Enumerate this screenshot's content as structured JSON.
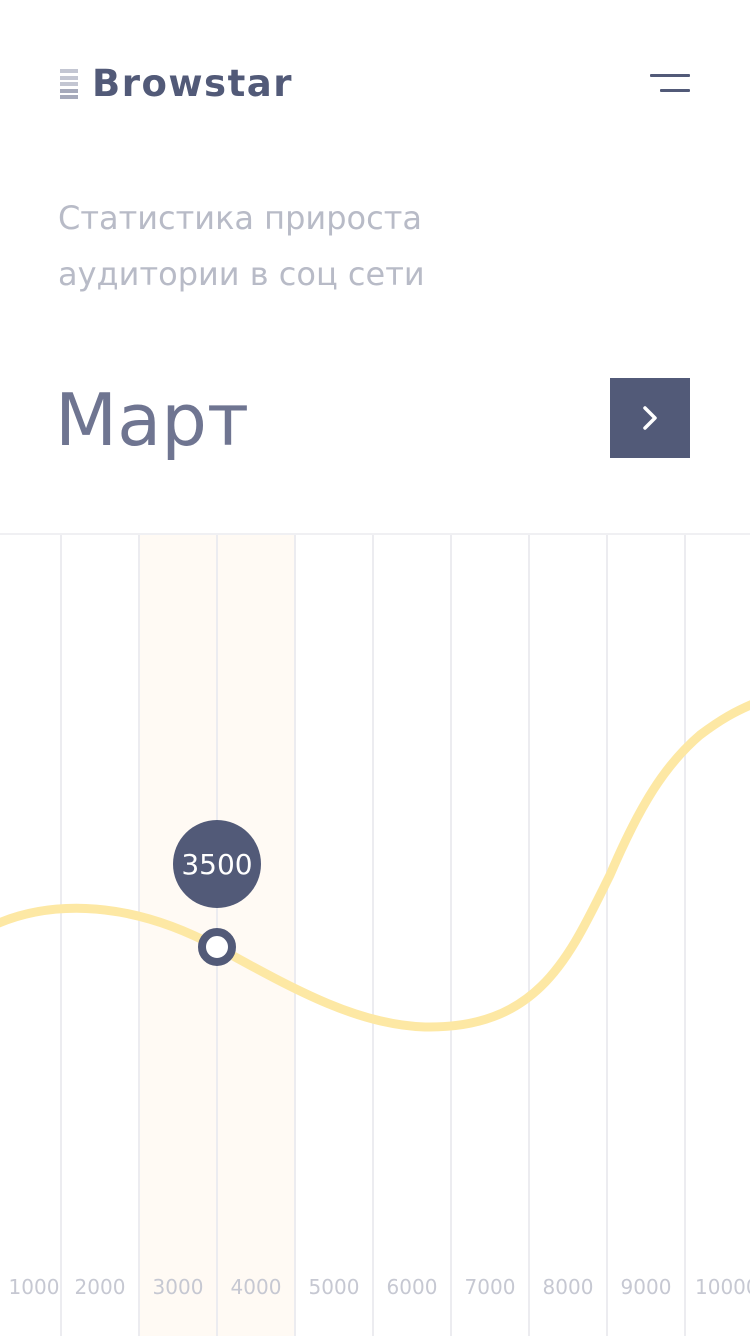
{
  "header": {
    "logo_text": "Browstar"
  },
  "page": {
    "subtitle_lines": [
      "Статистика прироста",
      "аудитории в соц сети"
    ],
    "month": "Март"
  },
  "icons": {
    "logo": "logo-bars-icon",
    "menu": "hamburger-menu-icon",
    "next": "chevron-right-icon"
  },
  "colors": {
    "primary": "#525a78",
    "curve": "#fde8a4",
    "highlight": "#fffaf4",
    "grid": "#ececf0",
    "tick_text": "#c6c8d2"
  },
  "chart_data": {
    "type": "line",
    "x_ticks": [
      "1000",
      "2000",
      "3000",
      "4000",
      "5000",
      "6000",
      "7000",
      "8000",
      "9000",
      "10000"
    ],
    "highlight_range": [
      "3000",
      "4000"
    ],
    "selected_point": {
      "x": "4000",
      "value": 3500,
      "label": "3500"
    }
  }
}
